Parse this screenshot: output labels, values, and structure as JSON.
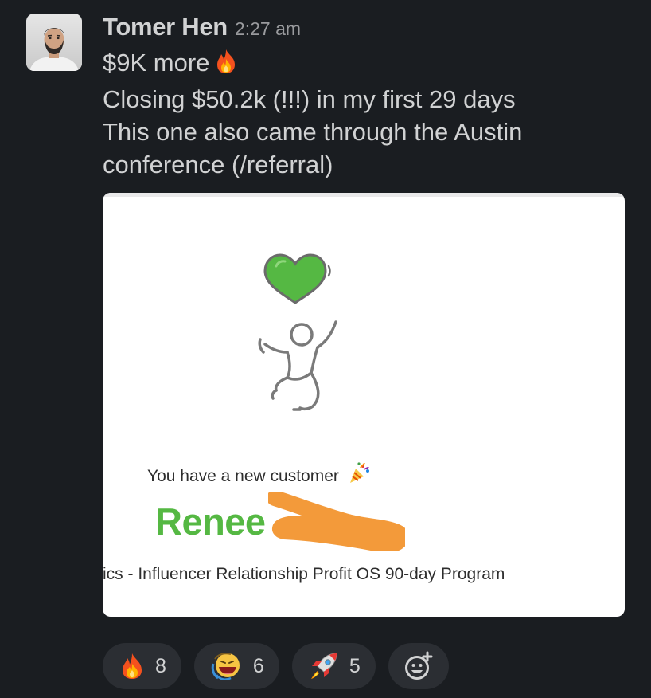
{
  "message": {
    "author": "Tomer Hen",
    "timestamp": "2:27 am",
    "lines": [
      "$9K more",
      "Closing $50.2k (!!!) in my first 29 days",
      "This one also came through the Austin",
      "conference (/referral)"
    ],
    "inline_emoji": "fire-emoji"
  },
  "attachment": {
    "notification": "You have a new customer",
    "notification_emoji": "party-popper-emoji",
    "customer_name": "Renee",
    "program": "ics - Influencer Relationship Profit OS 90-day Program",
    "name_color": "#55b843",
    "redaction_color": "#f39a3a"
  },
  "reactions": [
    {
      "emoji": "fire-emoji",
      "count": "8"
    },
    {
      "emoji": "laughing-face-emoji",
      "count": "6"
    },
    {
      "emoji": "rocket-emoji",
      "count": "5"
    }
  ],
  "add_reaction": {
    "icon": "add-emoji-icon"
  }
}
